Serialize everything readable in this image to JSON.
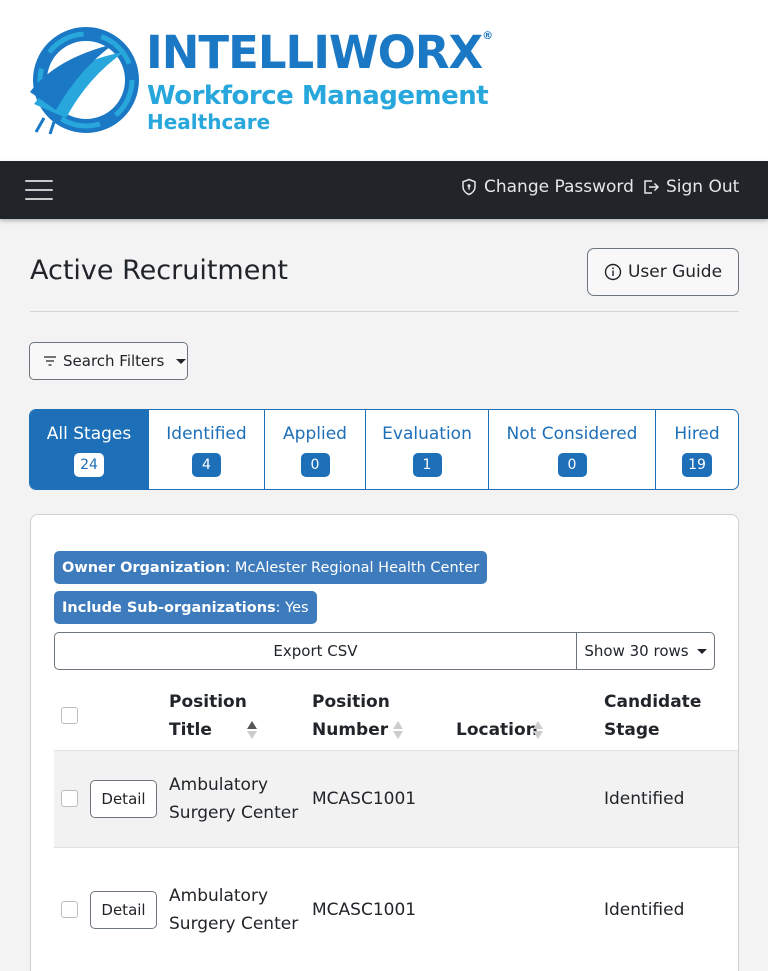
{
  "brand": {
    "name": "INTELLIWORX",
    "registered": "®",
    "line1": "Workforce Management",
    "line2": "Healthcare",
    "colors": {
      "primary": "#1b78c4",
      "secondary": "#27a7dc"
    }
  },
  "navbar": {
    "menu_icon": "hamburger-icon",
    "change_password": "Change Password",
    "sign_out": "Sign Out"
  },
  "page": {
    "title": "Active Recruitment",
    "user_guide": "User Guide",
    "search_filters": "Search Filters"
  },
  "stages": [
    {
      "label": "All Stages",
      "count": "24",
      "active": true
    },
    {
      "label": "Identified",
      "count": "4",
      "active": false
    },
    {
      "label": "Applied",
      "count": "0",
      "active": false
    },
    {
      "label": "Evaluation",
      "count": "1",
      "active": false
    },
    {
      "label": "Not Considered",
      "count": "0",
      "active": false
    },
    {
      "label": "Hired",
      "count": "19",
      "active": false
    }
  ],
  "filters_applied": {
    "owner_label": "Owner Organization",
    "owner_value": ": McAlester Regional Health Center",
    "sub_label": "Include Sub-organizations",
    "sub_value": ": Yes"
  },
  "toolbar": {
    "export": "Export CSV",
    "rows": "Show 30 rows"
  },
  "table": {
    "headers": {
      "position_title_1": "Position",
      "position_title_2": "Title",
      "position_number_1": "Position",
      "position_number_2": "Number",
      "location": "Location",
      "stage_1": "Candidate",
      "stage_2": "Stage"
    },
    "detail_label": "Detail",
    "rows": [
      {
        "title_1": "Ambulatory",
        "title_2": "Surgery Center",
        "number": "MCASC1001",
        "location": "",
        "stage": "Identified"
      },
      {
        "title_1": "Ambulatory",
        "title_2": "Surgery Center",
        "number": "MCASC1001",
        "location": "",
        "stage": "Identified"
      }
    ]
  }
}
